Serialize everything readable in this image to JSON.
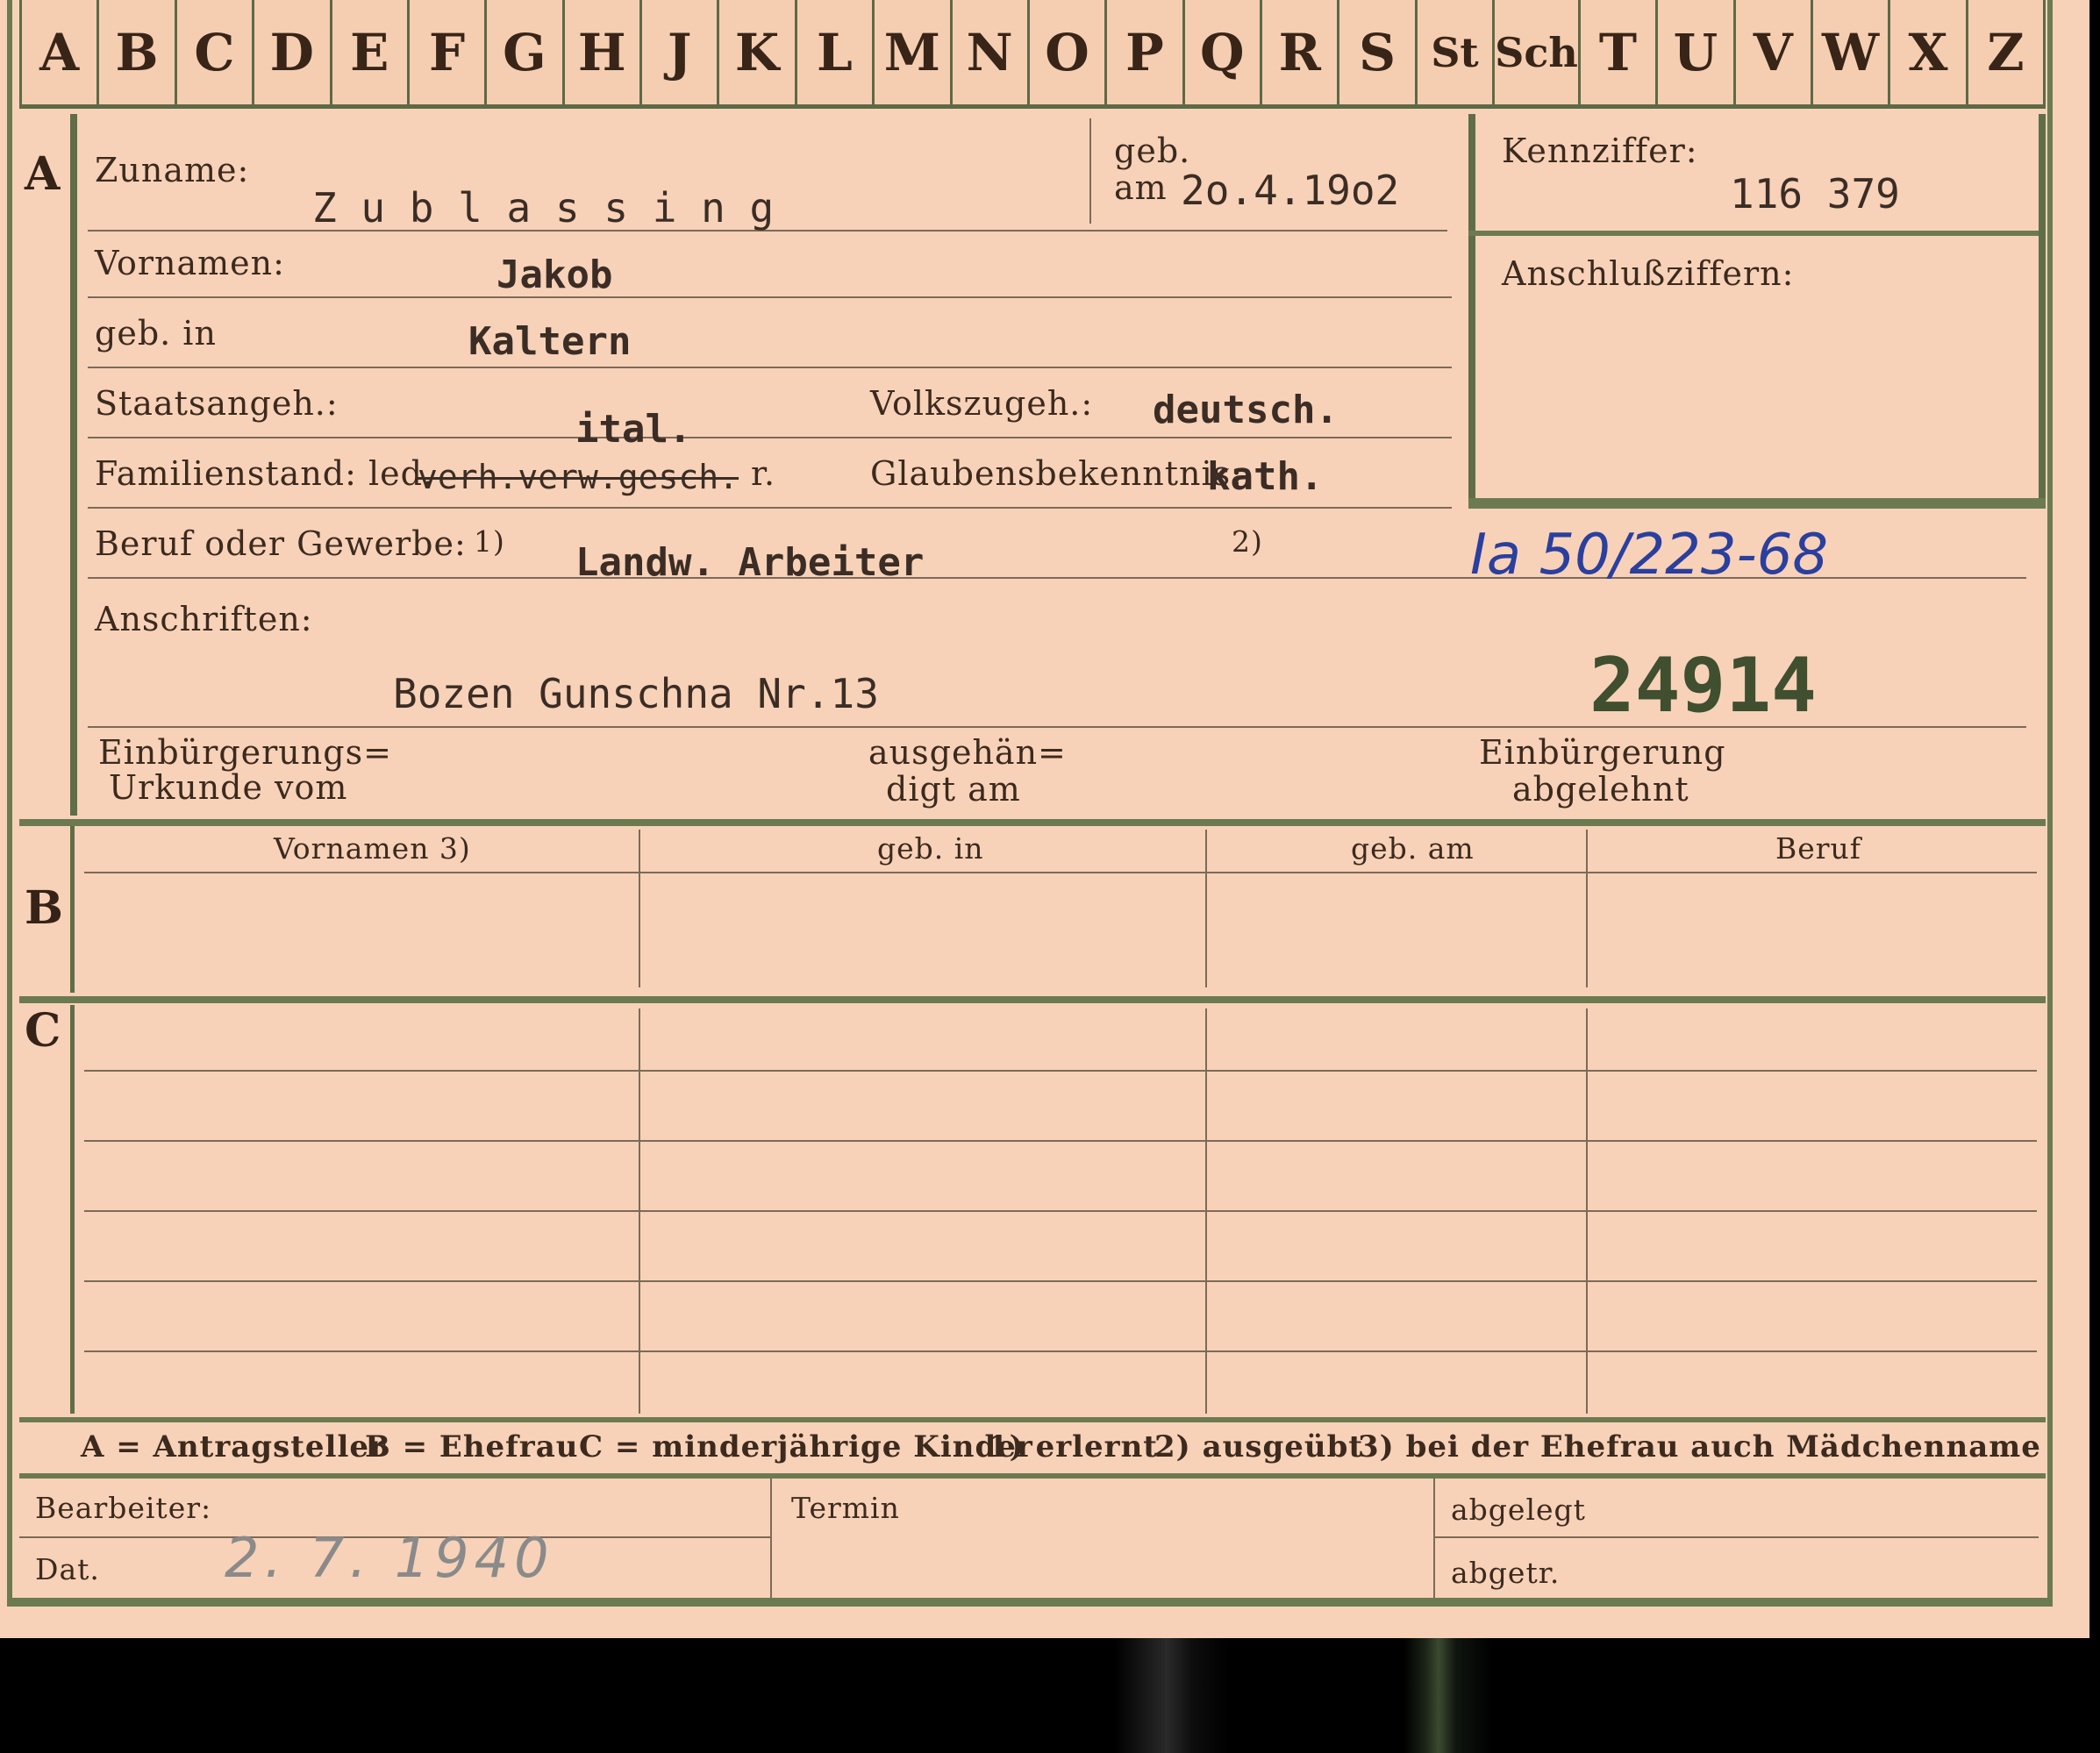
{
  "alphabet": [
    "A",
    "B",
    "C",
    "D",
    "E",
    "F",
    "G",
    "H",
    "J",
    "K",
    "L",
    "M",
    "N",
    "O",
    "P",
    "Q",
    "R",
    "S",
    "St",
    "Sch",
    "T",
    "U",
    "V",
    "W",
    "X",
    "Z"
  ],
  "sections": {
    "a": "A",
    "b": "B",
    "c": "C"
  },
  "labels": {
    "zuname": "Zuname:",
    "geb": "geb.",
    "am": "am",
    "vornamen": "Vornamen:",
    "geb_in": "geb. in",
    "staatsangeh": "Staatsangeh.:",
    "volkszugeh": "Volkszugeh.:",
    "familienstand": "Familienstand: led.",
    "glaubensbekenntnis": "Glaubensbekenntnis:",
    "beruf": "Beruf oder Gewerbe:",
    "fn1": "1)",
    "fn2": "2)",
    "anschriften": "Anschriften:",
    "kennziffer": "Kennziffer:",
    "anschlussziffern": "Anschlußziffern:",
    "einbuergerung_urkunde_1": "Einbürgerungs=",
    "einbuergerung_urkunde_2": "Urkunde vom",
    "ausgehaendigt_1": "ausgehän=",
    "ausgehaendigt_2": "digt am",
    "einbuergerung_abgelehnt_1": "Einbürgerung",
    "einbuergerung_abgelehnt_2": "abgelehnt"
  },
  "person": {
    "surname": "Z u b l a s s i n g",
    "birth_date": "2o.4.19o2",
    "given_names": "Jakob",
    "birth_place": "Kaltern",
    "citizenship": "ital.",
    "ethnicity": "deutsch.",
    "marital_status_struck": "verh.verw.gesch.",
    "marital_status_suffix": "r.",
    "religion": "kath.",
    "occupation": "Landw. Arbeiter",
    "address": "Bozen Gunschna Nr.13",
    "id_number": "116 379",
    "file_reference": "Ia 50/223-68",
    "stamp_number": "24914"
  },
  "table_headers": [
    "Vornamen 3)",
    "geb. in",
    "geb. am",
    "Beruf"
  ],
  "legend": {
    "a": "A = Antragsteller",
    "b": "B = Ehefrau",
    "c": "C = minderjährige Kinder",
    "n1": "1) erlernt",
    "n2": "2) ausgeübt",
    "n3": "3) bei der Ehefrau auch Mädchenname"
  },
  "footer": {
    "bearbeiter": "Bearbeiter:",
    "dat": "Dat.",
    "date_value": "2. 7. 1940",
    "termin": "Termin",
    "abgelegt": "abgelegt",
    "abgetr": "abgetr."
  },
  "colors": {
    "card": "#f7d2b8",
    "rule_green": "#6c7a52",
    "ink_blue": "#2a3f9e",
    "pencil": "#8a8a8a"
  }
}
